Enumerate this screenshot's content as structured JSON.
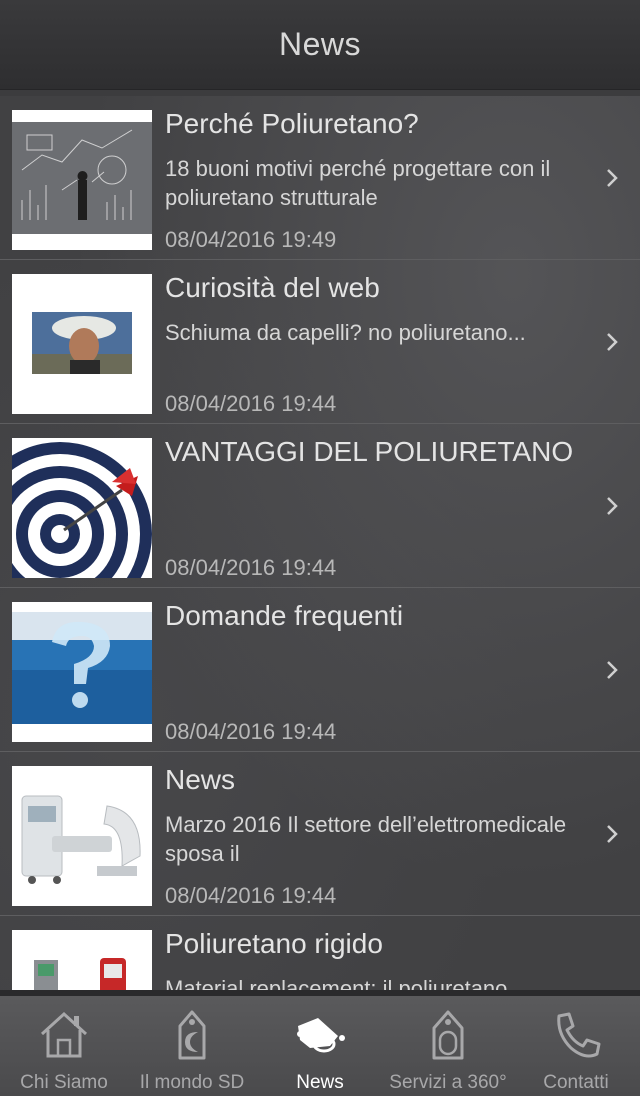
{
  "navbar": {
    "title": "News"
  },
  "news": [
    {
      "title": "Perché Poliuretano?",
      "subtitle": "18 buoni motivi perché progettare con il poliuretano strutturale",
      "date": "08/04/2016 19:49",
      "thumb_icon": "business-chart-image"
    },
    {
      "title": "Curiosità del web",
      "subtitle": "Schiuma da capelli? no poliuretano...",
      "date": "08/04/2016 19:44",
      "thumb_icon": "foam-hair-photo"
    },
    {
      "title": "VANTAGGI DEL POLIURETANO",
      "subtitle": "",
      "date": "08/04/2016 19:44",
      "thumb_icon": "target-dart-image"
    },
    {
      "title": "Domande frequenti",
      "subtitle": "",
      "date": "08/04/2016 19:44",
      "thumb_icon": "iceberg-question-image"
    },
    {
      "title": "News",
      "subtitle": "Marzo 2016 Il settore dell’elettromedicale sposa il",
      "date": "08/04/2016 19:44",
      "thumb_icon": "medical-equipment-image"
    },
    {
      "title": "Poliuretano rigido",
      "subtitle": "Material replacement: il poliuretano",
      "date": "",
      "thumb_icon": "devices-image"
    }
  ],
  "tabbar": {
    "items": [
      {
        "label": "Chi Siamo",
        "icon": "house-icon",
        "active": false
      },
      {
        "label": "Il mondo SD",
        "icon": "tag-icon",
        "active": false
      },
      {
        "label": "News",
        "icon": "megaphone-icon",
        "active": true
      },
      {
        "label": "Servizi a 360°",
        "icon": "tag-outline-icon",
        "active": false
      },
      {
        "label": "Contatti",
        "icon": "phone-icon",
        "active": false
      }
    ]
  },
  "colors": {
    "active_tab": "#ffffff",
    "inactive_tab": "#a8a8aa",
    "background": "#414143"
  }
}
